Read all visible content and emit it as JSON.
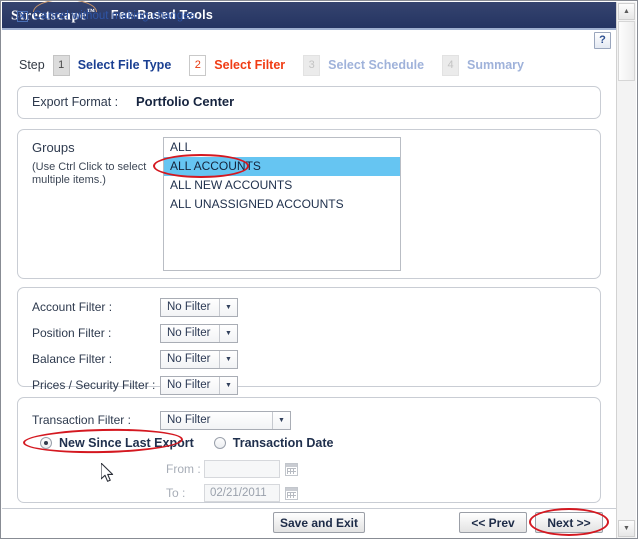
{
  "window": {
    "brand": "Streetscape",
    "brand_tm": "™",
    "app_title": "Fee-Based Tools"
  },
  "help": {
    "label": "?",
    "name": "help-icon"
  },
  "steps": {
    "prefix": "Step",
    "items": [
      {
        "num": "1",
        "label": "Select File Type",
        "state": "done"
      },
      {
        "num": "2",
        "label": "Select Filter",
        "state": "current"
      },
      {
        "num": "3",
        "label": "Select Schedule",
        "state": "muted"
      },
      {
        "num": "4",
        "label": "Summary",
        "state": "muted"
      }
    ]
  },
  "export_format": {
    "label": "Export Format :",
    "value": "Portfolio Center"
  },
  "groups": {
    "label": "Groups",
    "hint": "(Use Ctrl Click to select multiple items.)",
    "items": [
      {
        "label": "ALL",
        "selected": false
      },
      {
        "label": "ALL ACCOUNTS",
        "selected": true
      },
      {
        "label": "ALL NEW ACCOUNTS",
        "selected": false
      },
      {
        "label": "ALL UNASSIGNED ACCOUNTS",
        "selected": false
      }
    ]
  },
  "filters": [
    {
      "label": "Account Filter :",
      "value": "No Filter"
    },
    {
      "label": "Position Filter :",
      "value": "No Filter"
    },
    {
      "label": "Balance Filter :",
      "value": "No Filter"
    },
    {
      "label": "Prices / Security Filter :",
      "value": "No Filter"
    }
  ],
  "transaction": {
    "label": "Transaction Filter :",
    "value": "No Filter",
    "radio_new_label": "New Since Last Export",
    "radio_date_label": "Transaction Date",
    "radio_selected": "new_since_last_export",
    "from_label": "From :",
    "from_value": "",
    "to_label": "To :",
    "to_value": "02/21/2011"
  },
  "bottom": {
    "cancel_icon": "X",
    "cancel_label": "Cancel without making changes.",
    "save_label": "Save and Exit",
    "prev_label": "<< Prev",
    "next_label": "Next >>"
  },
  "scrollbar": {
    "up_arrow": "▲",
    "down_arrow": "▼"
  },
  "colors": {
    "header_navy": "#2b3a6b",
    "current_step_red": "#f03c14",
    "done_step_blue": "#1a3f92",
    "muted_step_blue": "#9fb2da",
    "selection_blue": "#66c5f2",
    "annotation_red": "#d41820",
    "link_blue": "#2f55a6"
  }
}
